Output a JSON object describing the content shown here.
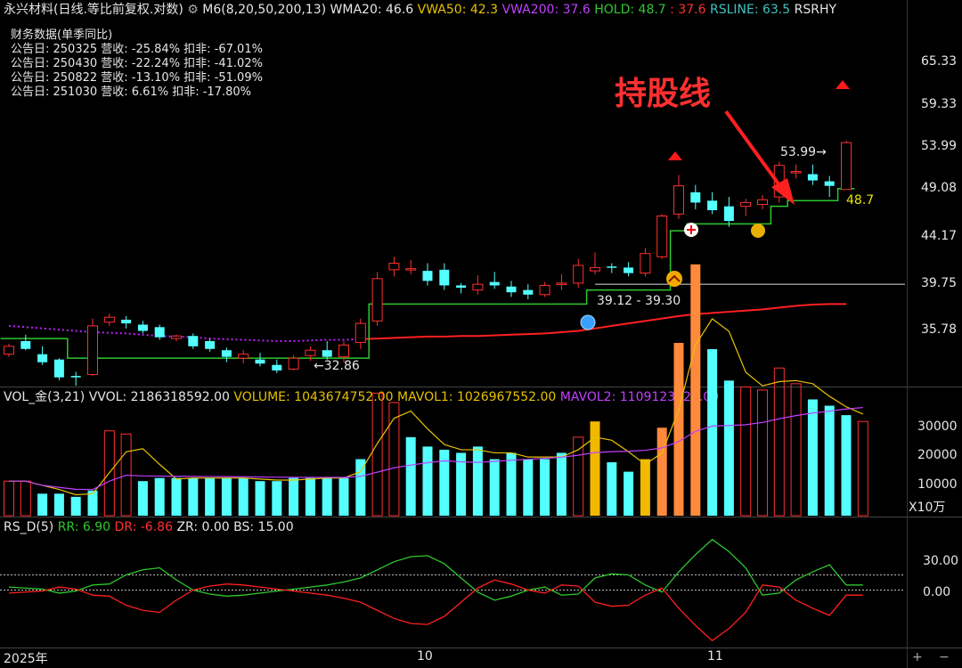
{
  "header": {
    "title": "永兴材料(日线.等比前复权.对数)",
    "ind_name": "M6(8,20,50,200,13)",
    "wma20": "WMA20: 46.6",
    "vwa50": "VWA50: 42.3",
    "vwa200": "VWA200: 37.6",
    "hold": "HOLD: 48.7",
    "hold2": ": 37.6",
    "rsline": "RSLINE: 63.5",
    "rsrhy": "RSRHY"
  },
  "financial": {
    "title": "财务数据(单季同比)",
    "rows": [
      "公告日: 250325  营收: -25.84%   扣非:  -67.01%",
      "公告日: 250430  营收: -22.24%   扣非:  -41.02%",
      "公告日: 250822  营收: -13.10%   扣非:  -51.09%",
      "公告日: 251030  营收:  6.61%   扣非:  -17.80%"
    ]
  },
  "annotation": {
    "text": "持股线",
    "color": "#ff3030"
  },
  "labels": {
    "low": "32.86",
    "high": "53.99",
    "range": "39.12 - 39.30",
    "hold_val": "48.7"
  },
  "price_axis": [
    "65.33",
    "59.33",
    "53.99",
    "49.08",
    "44.17",
    "39.75",
    "35.78"
  ],
  "vol_header": {
    "name": "VOL_金(3,21)",
    "vvol": "VVOL: 2186318592.00",
    "volume": "VOLUME: 1043674752.00",
    "mavol1": "MAVOL1: 1026967552.00",
    "mavol2": "MAVOL2: 1109123328.00"
  },
  "vol_axis": [
    "30000",
    "20000",
    "10000"
  ],
  "vol_unit": "X10万",
  "rs_header": {
    "name": "RS_D(5)",
    "rr": "RR: 6.90",
    "dr": "DR: -6.86",
    "zr": "ZR: 0.00",
    "bs": "BS: 15.00"
  },
  "rs_axis": [
    "30.00",
    "0.00"
  ],
  "time_axis": [
    "2025年",
    "10",
    "11"
  ],
  "colors": {
    "up": "#ff3030",
    "down": "#54ffff",
    "hold": "#2ec82e",
    "wma": "#ff2020",
    "dots": "#c020ff",
    "mavol1": "#e6c200",
    "mavol2": "#c040ff",
    "rr": "#2ec82e",
    "dr": "#ff2020"
  },
  "chart_data": {
    "type": "candlestick",
    "scale": "log",
    "price_range": [
      31.5,
      70.0
    ],
    "candles": [
      [
        33.6,
        34.4,
        33.4,
        34.2
      ],
      [
        34.6,
        35.1,
        33.9,
        34.0
      ],
      [
        33.6,
        34.2,
        32.8,
        33.0
      ],
      [
        33.2,
        33.3,
        31.7,
        31.9
      ],
      [
        32.0,
        32.3,
        31.3,
        31.9
      ],
      [
        32.1,
        36.4,
        32.0,
        35.8
      ],
      [
        36.1,
        36.8,
        35.8,
        36.5
      ],
      [
        36.3,
        36.6,
        35.6,
        36.0
      ],
      [
        35.9,
        36.2,
        35.2,
        35.4
      ],
      [
        35.7,
        35.9,
        34.7,
        34.9
      ],
      [
        34.8,
        35.1,
        34.6,
        35.0
      ],
      [
        35.0,
        35.2,
        34.0,
        34.2
      ],
      [
        34.6,
        34.8,
        33.8,
        34.0
      ],
      [
        33.9,
        34.1,
        33.0,
        33.4
      ],
      [
        33.3,
        33.9,
        32.9,
        33.6
      ],
      [
        33.2,
        33.7,
        32.7,
        32.9
      ],
      [
        32.8,
        33.2,
        32.2,
        32.4
      ],
      [
        32.5,
        33.5,
        32.4,
        33.3
      ],
      [
        33.5,
        34.2,
        33.1,
        33.9
      ],
      [
        33.9,
        34.6,
        33.2,
        33.4
      ],
      [
        33.4,
        34.6,
        33.0,
        34.3
      ],
      [
        34.5,
        36.4,
        34.0,
        36.0
      ],
      [
        36.2,
        40.4,
        35.8,
        39.8
      ],
      [
        40.6,
        41.8,
        40.0,
        41.2
      ],
      [
        40.6,
        41.5,
        40.2,
        40.7
      ],
      [
        40.5,
        41.2,
        39.2,
        39.6
      ],
      [
        40.6,
        41.2,
        38.8,
        39.2
      ],
      [
        39.2,
        39.4,
        38.5,
        39.0
      ],
      [
        38.8,
        40.1,
        38.4,
        39.3
      ],
      [
        39.5,
        40.4,
        38.9,
        39.2
      ],
      [
        39.1,
        39.6,
        38.2,
        38.6
      ],
      [
        38.8,
        39.3,
        38.0,
        38.4
      ],
      [
        38.4,
        39.5,
        38.2,
        39.2
      ],
      [
        39.3,
        40.2,
        38.8,
        39.4
      ],
      [
        39.4,
        41.6,
        39.0,
        41.0
      ],
      [
        40.5,
        42.2,
        40.2,
        40.8
      ],
      [
        40.9,
        41.2,
        40.3,
        40.8
      ],
      [
        40.8,
        41.3,
        40.0,
        40.3
      ],
      [
        40.3,
        42.6,
        40.0,
        42.1
      ],
      [
        41.8,
        46.0,
        41.6,
        45.8
      ],
      [
        46.0,
        50.2,
        45.5,
        49.0
      ],
      [
        48.3,
        49.1,
        46.5,
        47.2
      ],
      [
        47.4,
        48.3,
        46.0,
        46.4
      ],
      [
        46.8,
        47.8,
        44.7,
        45.3
      ],
      [
        46.8,
        47.6,
        45.8,
        47.2
      ],
      [
        47.0,
        48.0,
        46.5,
        47.5
      ],
      [
        47.8,
        51.7,
        47.2,
        51.3
      ],
      [
        50.5,
        51.4,
        49.8,
        50.6
      ],
      [
        50.3,
        51.4,
        49.1,
        49.6
      ],
      [
        49.5,
        50.1,
        47.8,
        49.0
      ],
      [
        48.6,
        54.2,
        48.6,
        53.99
      ]
    ],
    "hold_line": [
      34.8,
      34.8,
      34.8,
      34.8,
      33.3,
      33.3,
      33.3,
      33.3,
      33.3,
      33.3,
      33.3,
      33.3,
      33.3,
      33.3,
      33.3,
      33.3,
      33.3,
      33.3,
      33.3,
      33.3,
      33.3,
      33.3,
      37.6,
      37.6,
      37.6,
      37.6,
      37.6,
      37.6,
      37.6,
      37.6,
      37.6,
      37.6,
      37.6,
      37.6,
      37.6,
      38.8,
      38.8,
      38.8,
      38.8,
      38.8,
      44.3,
      45.0,
      45.0,
      45.0,
      45.0,
      45.0,
      46.8,
      47.4,
      47.4,
      47.4,
      48.7
    ],
    "wma200": [
      35.8,
      35.7,
      35.6,
      35.5,
      35.4,
      35.3,
      35.25,
      35.2,
      35.1,
      35.0,
      34.95,
      34.9,
      34.8,
      34.75,
      34.7,
      34.65,
      34.6,
      34.6,
      34.65,
      34.7,
      34.7,
      34.75,
      34.8,
      34.85,
      34.9,
      34.95,
      34.95,
      35.0,
      35.0,
      35.05,
      35.1,
      35.15,
      35.2,
      35.3,
      35.4,
      35.6,
      35.8,
      36.0,
      36.2,
      36.4,
      36.6,
      36.75,
      36.85,
      36.95,
      37.05,
      37.15,
      37.3,
      37.45,
      37.55,
      37.6,
      37.6
    ],
    "volume": [
      11,
      11,
      7,
      7,
      6,
      8,
      27,
      26,
      11,
      12,
      12,
      12,
      12,
      12,
      12,
      11,
      11,
      12,
      12,
      12,
      12,
      18,
      39,
      36,
      25,
      22,
      21,
      20,
      22,
      18,
      20,
      18,
      18,
      20,
      25,
      30,
      17,
      14,
      18,
      28,
      55,
      80,
      53,
      43,
      41,
      40,
      47,
      42,
      37,
      35,
      32,
      30
    ],
    "vol_colors": [
      "u",
      "u",
      "d",
      "d",
      "d",
      "d",
      "u",
      "u",
      "d",
      "d",
      "d",
      "d",
      "d",
      "d",
      "d",
      "d",
      "d",
      "d",
      "d",
      "d",
      "d",
      "d",
      "u",
      "u",
      "d",
      "d",
      "d",
      "d",
      "d",
      "d",
      "d",
      "d",
      "d",
      "d",
      "u",
      "y",
      "d",
      "d",
      "y",
      "o",
      "o",
      "o",
      "d",
      "d",
      "u",
      "u",
      "u",
      "u",
      "d",
      "d",
      "d",
      "u"
    ],
    "vol_range": [
      0,
      36000
    ],
    "rr": [
      3,
      2,
      1,
      -3,
      -1,
      5,
      6,
      15,
      20,
      22,
      10,
      0,
      -4,
      -6,
      -5,
      -3,
      -1,
      1,
      3,
      5,
      8,
      12,
      20,
      28,
      33,
      34,
      26,
      12,
      -2,
      -10,
      -6,
      0,
      3,
      -5,
      -4,
      12,
      16,
      15,
      5,
      -2,
      18,
      35,
      50,
      38,
      22,
      -5,
      -3,
      10,
      18,
      25,
      5,
      5
    ],
    "dr": [
      -3,
      -2,
      -1,
      3,
      1,
      -5,
      -6,
      -15,
      -20,
      -22,
      -10,
      0,
      4,
      6,
      5,
      3,
      1,
      -1,
      -3,
      -5,
      -8,
      -12,
      -20,
      -28,
      -33,
      -34,
      -26,
      -12,
      2,
      10,
      6,
      0,
      -3,
      5,
      4,
      -12,
      -16,
      -15,
      -5,
      2,
      -18,
      -35,
      -50,
      -38,
      -22,
      5,
      3,
      -10,
      -18,
      -25,
      -5,
      -5
    ],
    "rs_range": [
      -55,
      55
    ]
  }
}
